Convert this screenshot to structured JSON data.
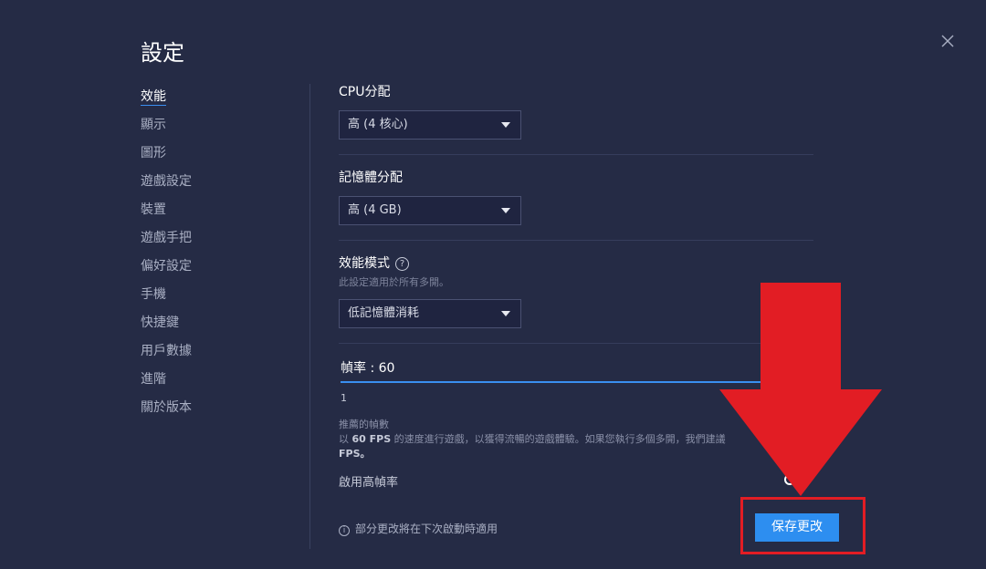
{
  "header": {
    "title": "設定"
  },
  "sidebar": {
    "items": [
      {
        "label": "效能",
        "active": true
      },
      {
        "label": "顯示"
      },
      {
        "label": "圖形"
      },
      {
        "label": "遊戲設定"
      },
      {
        "label": "裝置"
      },
      {
        "label": "遊戲手把"
      },
      {
        "label": "偏好設定"
      },
      {
        "label": "手機"
      },
      {
        "label": "快捷鍵"
      },
      {
        "label": "用戶數據"
      },
      {
        "label": "進階"
      },
      {
        "label": "關於版本"
      }
    ]
  },
  "cpu": {
    "label": "CPU分配",
    "value": "高 (4 核心)"
  },
  "memory": {
    "label": "記憶體分配",
    "value": "高 (4 GB)"
  },
  "performance_mode": {
    "label": "效能模式",
    "help": "?",
    "note": "此設定適用於所有多開。",
    "value": "低記憶體消耗"
  },
  "fps": {
    "label": "幀率 : 60",
    "value": 60,
    "min_label": "1",
    "recommended_title": "推薦的幀數",
    "description_prefix": "以 ",
    "description_bold": "60 FPS",
    "description_rest": " 的速度進行遊戲，以獲得流暢的遊戲體驗。如果您執行多個多開，我們建議",
    "description_line2": "FPS。"
  },
  "high_fps": {
    "label": "啟用高幀率"
  },
  "footer": {
    "info_icon": "i",
    "note": "部分更改將在下次啟動時適用",
    "save_label": "保存更改"
  },
  "colors": {
    "background": "#252b45",
    "accent": "#2d8ef0",
    "annotation": "#e21d24"
  }
}
